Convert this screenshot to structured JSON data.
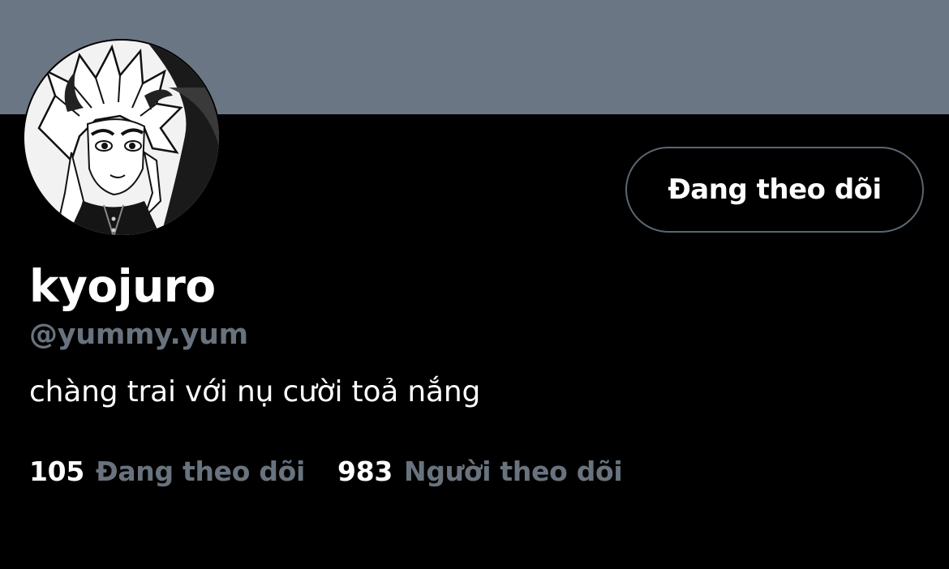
{
  "profile": {
    "display_name": "kyojuro",
    "handle": "@yummy.yum",
    "bio": "chàng trai với nụ cười toả nắng",
    "avatar_icon": "anime-character-avatar",
    "follow_button_label": "Đang theo dõi"
  },
  "stats": {
    "following_count": "105",
    "following_label": "Đang theo dõi",
    "followers_count": "983",
    "followers_label": "Người theo dõi"
  },
  "colors": {
    "banner": "#6a7683",
    "background": "#000000",
    "text_primary": "#ffffff",
    "text_secondary": "#68737e",
    "button_border": "#5b6670"
  }
}
